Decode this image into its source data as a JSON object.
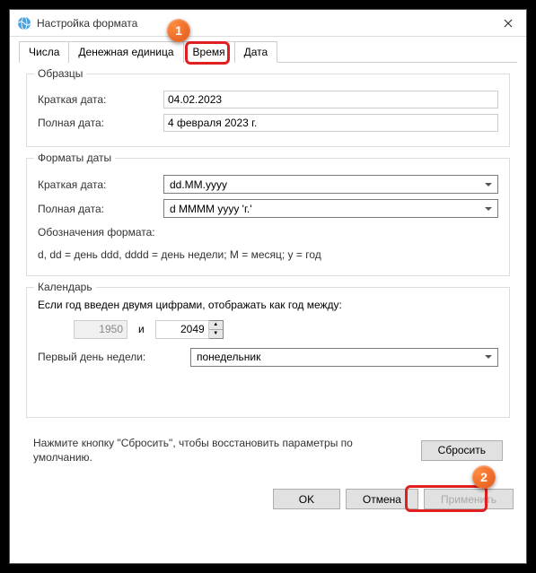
{
  "window": {
    "title": "Настройка формата"
  },
  "tabs": {
    "numbers": "Числа",
    "currency": "Денежная единица",
    "time": "Время",
    "date": "Дата"
  },
  "samples": {
    "title": "Образцы",
    "short_label": "Краткая дата:",
    "short_val": "04.02.2023",
    "long_label": "Полная дата:",
    "long_val": "4 февраля 2023 г."
  },
  "formats": {
    "title": "Форматы даты",
    "short_label": "Краткая дата:",
    "short_val": "dd.MM.yyyy",
    "long_label": "Полная дата:",
    "long_val": "d MMMM yyyy 'г.'",
    "notation_label": "Обозначения формата:",
    "notation_text": "d, dd = день  ddd, dddd = день недели; M = месяц; y = год"
  },
  "calendar": {
    "title": "Календарь",
    "year_text": "Если год введен двумя цифрами, отображать как год между:",
    "year_from": "1950",
    "and": "и",
    "year_to": "2049",
    "firstday_label": "Первый день недели:",
    "firstday_val": "понедельник"
  },
  "reset": {
    "text": "Нажмите кнопку \"Сбросить\", чтобы восстановить параметры по умолчанию.",
    "btn": "Сбросить"
  },
  "buttons": {
    "ok": "OK",
    "cancel": "Отмена",
    "apply": "Применить"
  },
  "markers": {
    "m1": "1",
    "m2": "2"
  }
}
